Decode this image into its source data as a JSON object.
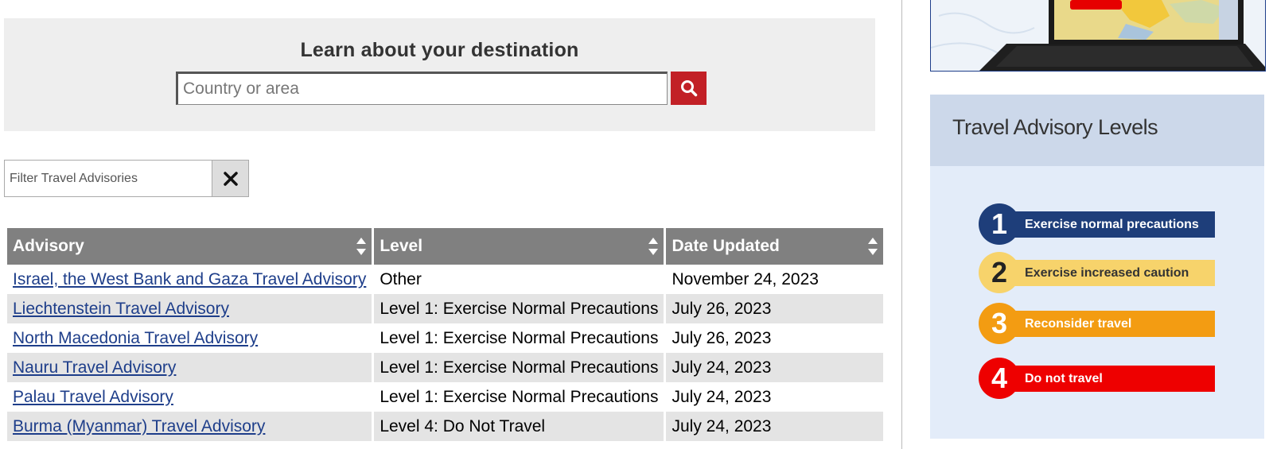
{
  "search": {
    "title": "Learn about your destination",
    "placeholder": "Country or area",
    "button_icon": "search-icon",
    "button_color": "#c22026"
  },
  "filter": {
    "placeholder": "Filter Travel Advisories",
    "clear_icon": "close-icon"
  },
  "table": {
    "headers": [
      "Advisory",
      "Level",
      "Date Updated"
    ],
    "rows": [
      {
        "advisory": "Israel, the West Bank and Gaza Travel Advisory",
        "level": "Other",
        "date": "November 24, 2023"
      },
      {
        "advisory": "Liechtenstein Travel Advisory",
        "level": "Level 1: Exercise Normal Precautions",
        "date": "July 26, 2023"
      },
      {
        "advisory": "North Macedonia Travel Advisory",
        "level": "Level 1: Exercise Normal Precautions",
        "date": "July 26, 2023"
      },
      {
        "advisory": "Nauru Travel Advisory",
        "level": "Level 1: Exercise Normal Precautions",
        "date": "July 24, 2023"
      },
      {
        "advisory": "Palau Travel Advisory",
        "level": "Level 1: Exercise Normal Precautions",
        "date": "July 24, 2023"
      },
      {
        "advisory": "Burma (Myanmar) Travel Advisory",
        "level": "Level 4: Do Not Travel",
        "date": "July 24, 2023"
      }
    ]
  },
  "sidebar": {
    "levels_title": "Travel Advisory Levels",
    "levels": [
      {
        "number": "1",
        "label": "Exercise normal precautions",
        "color": "#1e3e7a",
        "text_color": "#ffffff"
      },
      {
        "number": "2",
        "label": "Exercise increased caution",
        "color": "#f7d36b",
        "text_color": "#333333"
      },
      {
        "number": "3",
        "label": "Reconsider travel",
        "color": "#f39c12",
        "text_color": "#ffffff"
      },
      {
        "number": "4",
        "label": "Do not travel",
        "color": "#ee0000",
        "text_color": "#ffffff"
      }
    ]
  }
}
